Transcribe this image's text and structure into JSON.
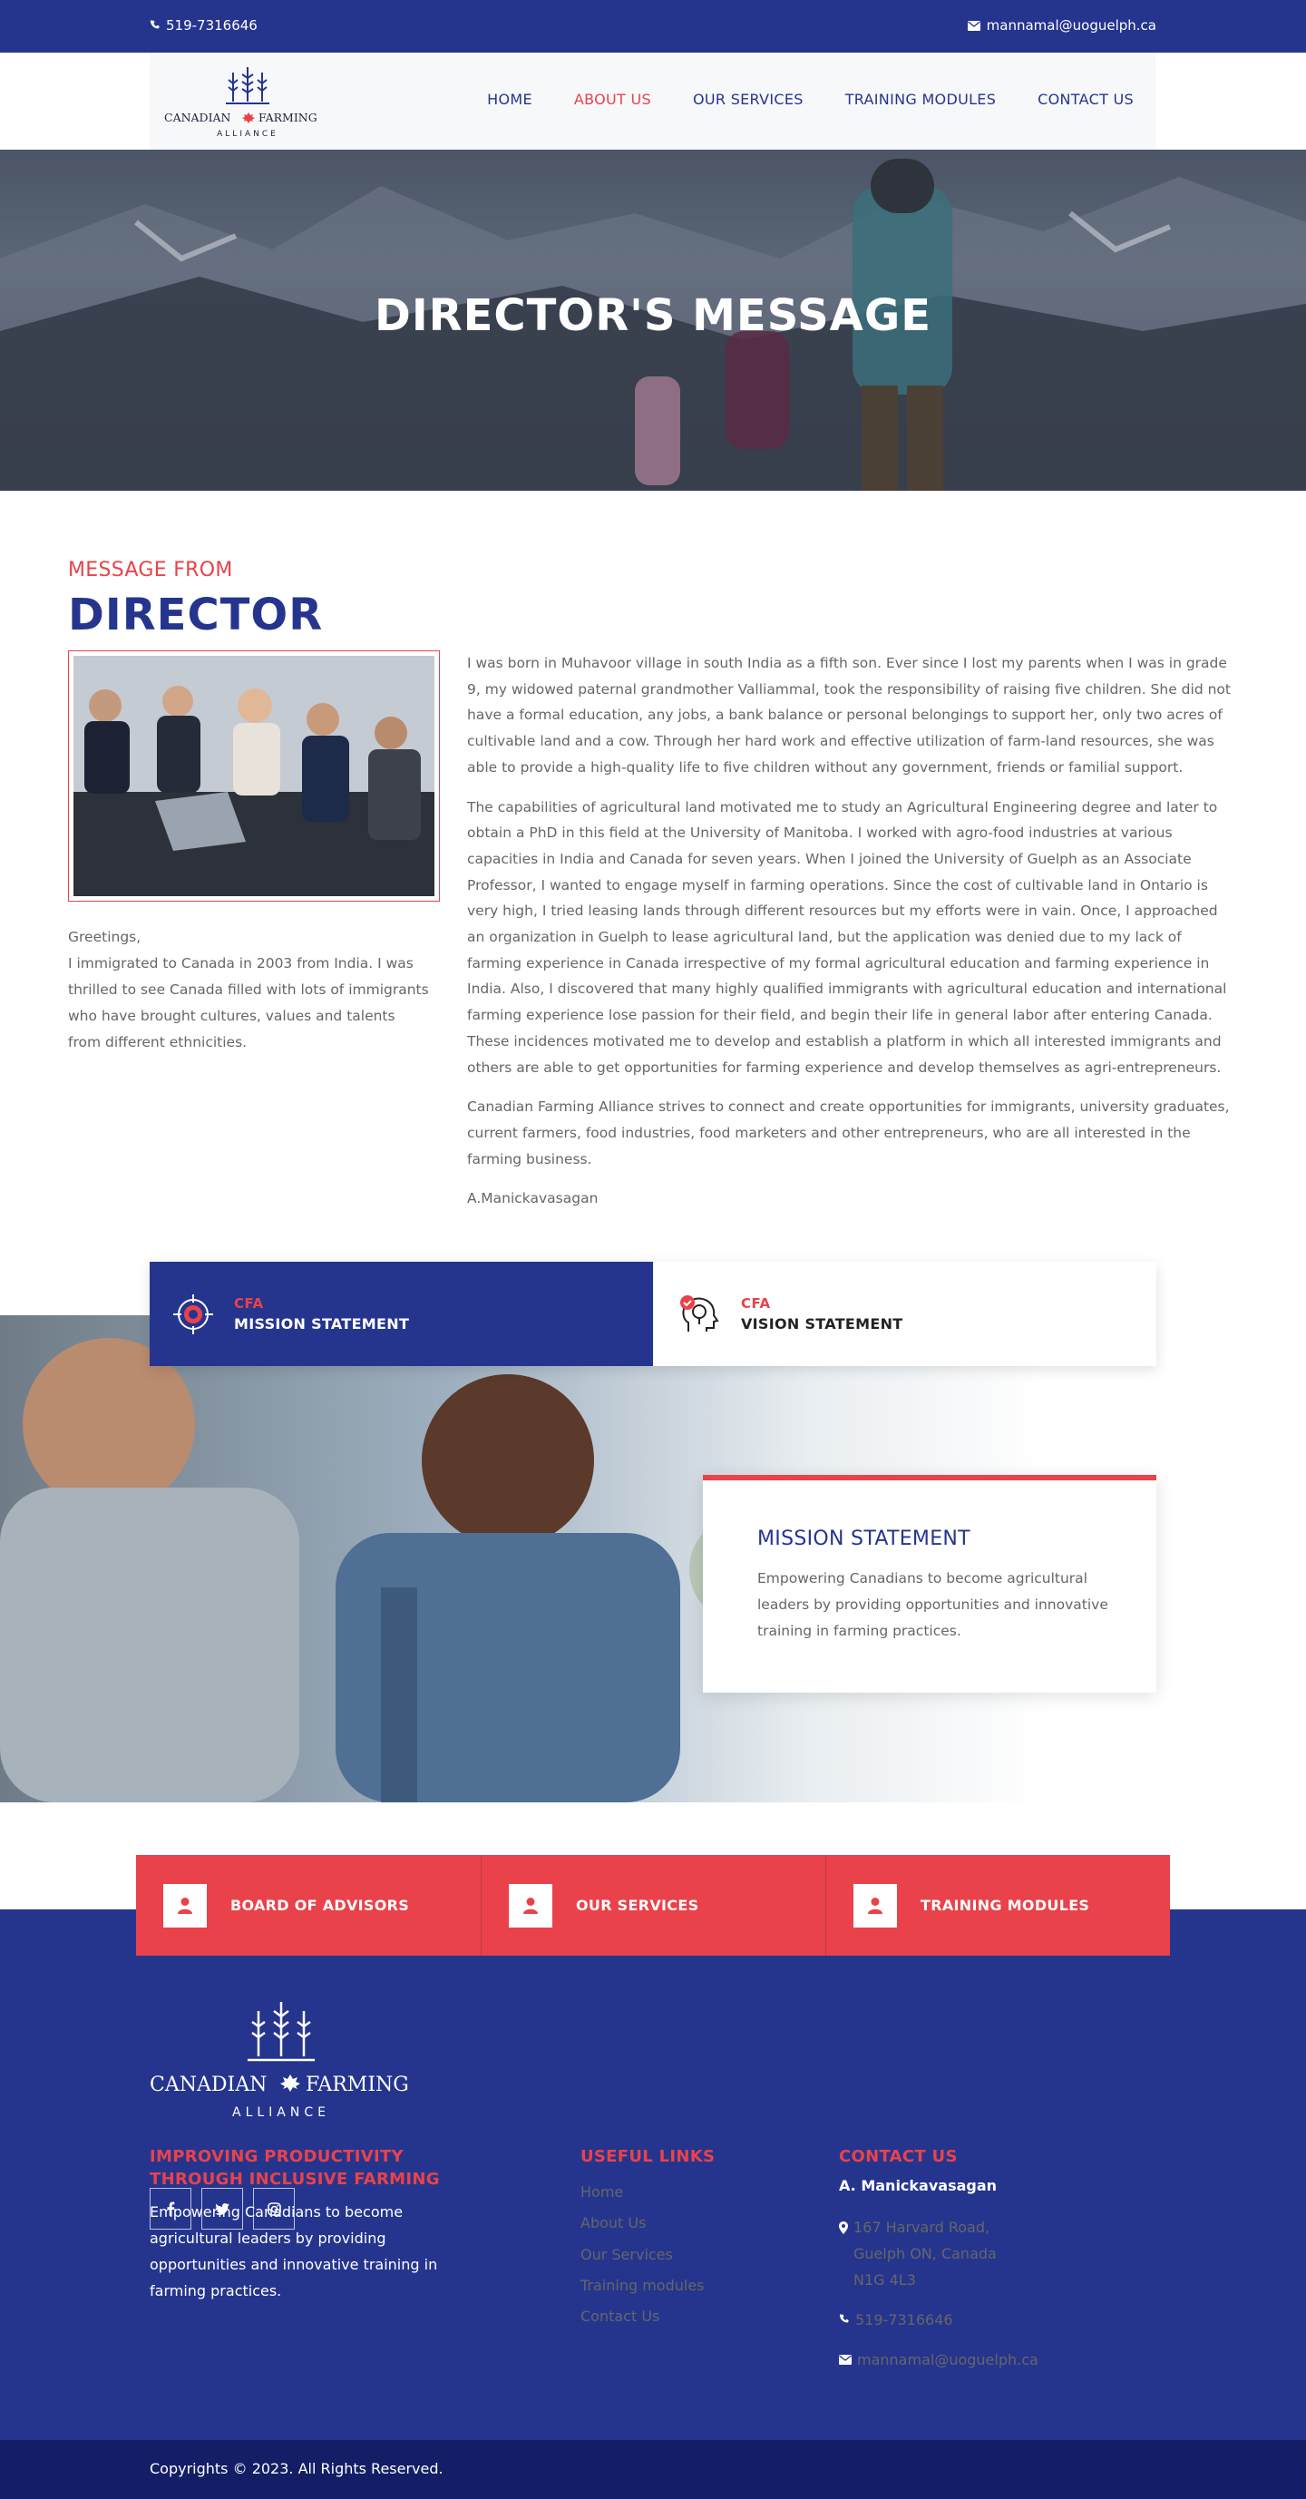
{
  "topbar": {
    "phone": "519-7316646",
    "email": "mannamal@uoguelph.ca"
  },
  "logo": {
    "line1": "CANADIAN",
    "line2": "FARMING",
    "line3": "ALLIANCE"
  },
  "nav": {
    "items": [
      "HOME",
      "ABOUT US",
      "OUR SERVICES",
      "TRAINING MODULES",
      "CONTACT US"
    ],
    "active": "ABOUT US"
  },
  "hero": {
    "title": "DIRECTOR'S MESSAGE"
  },
  "director": {
    "eyebrow": "MESSAGE FROM",
    "heading": "DIRECTOR",
    "greeting": "Greetings,",
    "intro": "I immigrated to Canada in 2003 from India. I was thrilled to see Canada filled with lots of immigrants who have brought cultures, values and talents from different ethnicities.",
    "paragraphs": [
      "I was born in Muhavoor village in south India as a fifth son. Ever since I lost my parents when I was in grade 9, my widowed paternal grandmother Valliammal, took the responsibility of raising five children. She did not have a formal education, any jobs, a bank balance or personal belongings to support her, only two acres of cultivable land and a cow. Through her hard work and effective utilization of farm-land resources, she was able to provide a high-quality life to five children without any government, friends or familial support.",
      "The capabilities of agricultural land motivated me to study an Agricultural Engineering degree and later to obtain a PhD in this field at the University of Manitoba. I worked with agro-food industries at various capacities in India and Canada for seven years. When I joined the University of Guelph as an Associate Professor, I wanted to engage myself in farming operations. Since the cost of cultivable land in Ontario is very high, I tried leasing lands through different resources but my efforts were in vain. Once, I approached an organization in Guelph to lease agricultural land, but the application was denied due to my lack of farming experience in Canada irrespective of my formal agricultural education and farming experience in India. Also, I discovered that many highly qualified immigrants with agricultural education and international farming experience lose passion for their field, and begin their life in general labor after entering Canada. These incidences motivated me to develop and establish a platform in which all interested immigrants and others are able to get opportunities for farming experience and develop themselves as agri-entrepreneurs.",
      "Canadian Farming Alliance strives to connect and create opportunities for immigrants, university graduates, current farmers, food industries, food marketers and other entrepreneurs, who are all interested in the farming business."
    ],
    "signature": "A.Manickavasagan"
  },
  "tabs": [
    {
      "small": "CFA",
      "label": "MISSION STATEMENT",
      "active": true
    },
    {
      "small": "CFA",
      "label": "VISION STATEMENT",
      "active": false
    }
  ],
  "mission": {
    "title": "MISSION STATEMENT",
    "text": "Empowering Canadians to become agricultural leaders by providing opportunities and innovative training in farming practices."
  },
  "features": [
    "BOARD OF ADVISORS",
    "OUR SERVICES",
    "TRAINING MODULES"
  ],
  "footer": {
    "tagline_line1": "IMPROVING PRODUCTIVITY",
    "tagline_line2": "THROUGH INCLUSIVE FARMING",
    "about": "Empowering Canadians to become agricultural leaders by providing opportunities and innovative training in farming practices.",
    "useful_links_title": "USEFUL LINKS",
    "links": [
      "Home",
      "About Us",
      "Our Services",
      "Training modules",
      "Contact Us"
    ],
    "contact_title": "CONTACT US",
    "contact_name": "A. Manickavasagan",
    "address_line1": "167 Harvard Road,",
    "address_line2": "Guelph ON, Canada",
    "address_line3": "N1G 4L3",
    "phone": "519-7316646",
    "email": "mannamal@uoguelph.ca",
    "copyright": "Copyrights © 2023. All Rights Reserved."
  },
  "colors": {
    "brand_blue": "#25358e",
    "accent_red": "#e9424a",
    "footer_dark": "#131e66"
  },
  "icons": {
    "phone": "phone-icon",
    "email": "envelope-icon",
    "mission": "target-icon",
    "vision": "head-idea-icon",
    "feature": "user-icon",
    "social": [
      "facebook-icon",
      "twitter-icon",
      "instagram-icon"
    ],
    "address": "map-marker-icon"
  }
}
